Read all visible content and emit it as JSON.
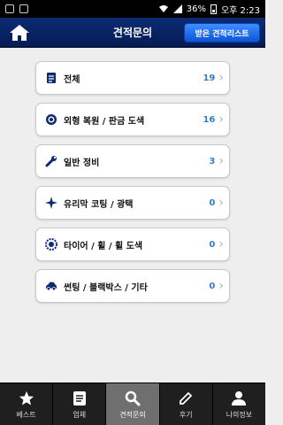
{
  "status_bar": {
    "battery": "36%",
    "time": "오후 2:23"
  },
  "header": {
    "title": "견적문의",
    "received_button": "받은 견적리스트",
    "home_icon": "home-icon"
  },
  "list": {
    "items": [
      {
        "icon": "document-icon",
        "label": "전체",
        "count": "19"
      },
      {
        "icon": "target-icon",
        "label": "외형 복원 / 판금 도색",
        "count": "16"
      },
      {
        "icon": "wrench-icon",
        "label": "일반 정비",
        "count": "3"
      },
      {
        "icon": "sparkle-icon",
        "label": "유리막 코팅 / 광택",
        "count": "0"
      },
      {
        "icon": "tire-icon",
        "label": "타이어 / 휠 / 휠 도색",
        "count": "0"
      },
      {
        "icon": "car-icon",
        "label": "썬팅 / 블랙박스 / 기타",
        "count": "0"
      }
    ]
  },
  "tabs": [
    {
      "icon": "star-icon",
      "label": "베스트"
    },
    {
      "icon": "document-icon",
      "label": "업체"
    },
    {
      "icon": "search-icon",
      "label": "견적문의",
      "active": true
    },
    {
      "icon": "pencil-icon",
      "label": "후기"
    },
    {
      "icon": "person-icon",
      "label": "나의정보"
    }
  ],
  "colors": {
    "header": "#0b2b73",
    "accent": "#2f7fd1",
    "active_tab": "#6f6f6f"
  }
}
